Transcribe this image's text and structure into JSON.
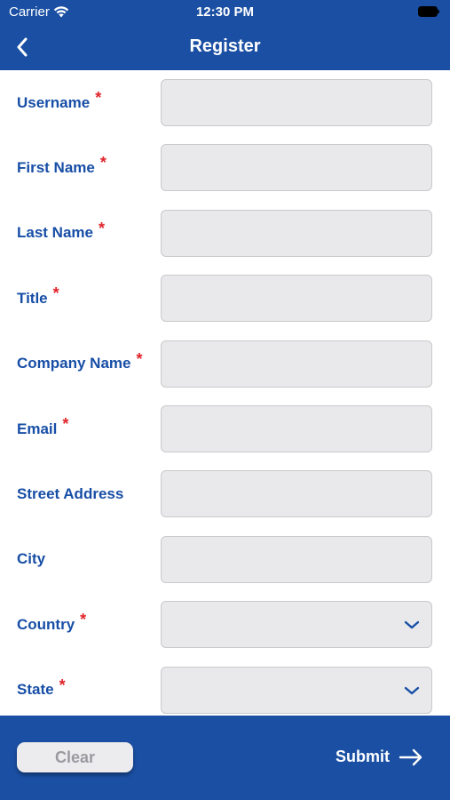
{
  "status_bar": {
    "carrier": "Carrier",
    "time": "12:30 PM"
  },
  "nav": {
    "title": "Register",
    "back_icon": "chevron-left-icon"
  },
  "required_marker": "*",
  "form": {
    "fields": [
      {
        "label": "Username",
        "required": true,
        "type": "text",
        "value": ""
      },
      {
        "label": "First Name",
        "required": true,
        "type": "text",
        "value": ""
      },
      {
        "label": "Last Name",
        "required": true,
        "type": "text",
        "value": ""
      },
      {
        "label": "Title",
        "required": true,
        "type": "text",
        "value": ""
      },
      {
        "label": "Company Name",
        "required": true,
        "type": "text",
        "value": ""
      },
      {
        "label": "Email",
        "required": true,
        "type": "text",
        "value": ""
      },
      {
        "label": "Street Address",
        "required": false,
        "type": "text",
        "value": ""
      },
      {
        "label": "City",
        "required": false,
        "type": "text",
        "value": ""
      },
      {
        "label": "Country",
        "required": true,
        "type": "select",
        "value": ""
      },
      {
        "label": "State",
        "required": true,
        "type": "select",
        "value": ""
      }
    ]
  },
  "footer": {
    "clear_label": "Clear",
    "submit_label": "Submit"
  },
  "colors": {
    "primary": "#1a4fa3",
    "label": "#174ea6",
    "required": "#e0242b",
    "field_bg": "#e9e9eb"
  }
}
